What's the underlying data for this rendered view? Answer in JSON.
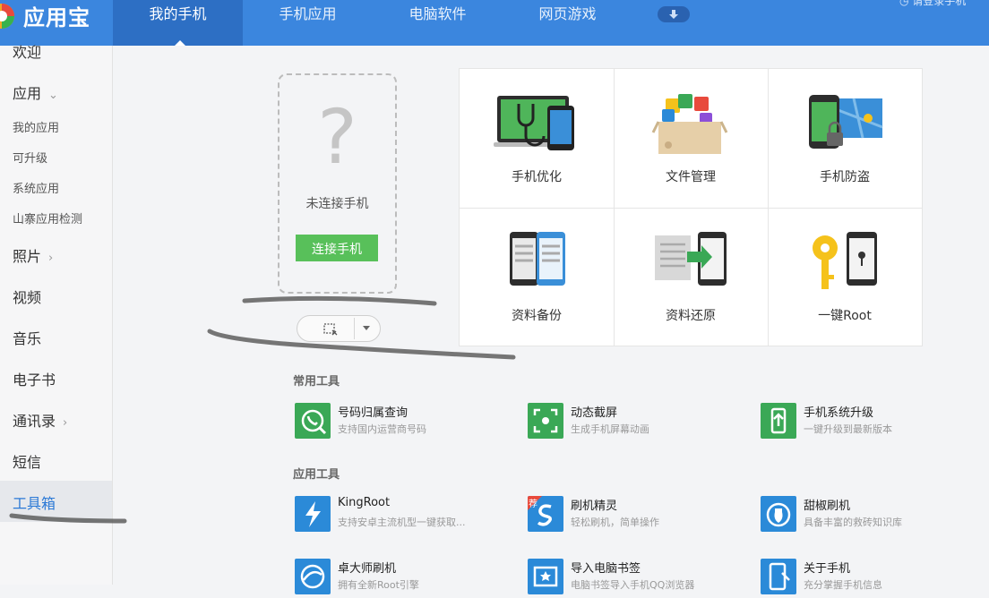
{
  "app": {
    "title": "应用宝",
    "brand_color": "#3b86de"
  },
  "nav": {
    "tabs": [
      {
        "label": "我的手机"
      },
      {
        "label": "手机应用"
      },
      {
        "label": "电脑软件"
      },
      {
        "label": "网页游戏"
      }
    ],
    "active_tab": "我的手机",
    "top_right_text": "请登录手机"
  },
  "sidebar": {
    "items": [
      {
        "label": "欢迎"
      },
      {
        "label": "应用"
      },
      {
        "label": "我的应用"
      },
      {
        "label": "可升级"
      },
      {
        "label": "系统应用"
      },
      {
        "label": "山寨应用检测"
      },
      {
        "label": "照片"
      },
      {
        "label": "视频"
      },
      {
        "label": "音乐"
      },
      {
        "label": "电子书"
      },
      {
        "label": "通讯录"
      },
      {
        "label": "短信"
      },
      {
        "label": "工具箱"
      }
    ],
    "active": "工具箱"
  },
  "device": {
    "status": "未连接手机",
    "connect_button": "连接手机",
    "placeholder_glyph": "?"
  },
  "features": [
    {
      "label": "手机优化",
      "icon": "phone-optimize-icon"
    },
    {
      "label": "文件管理",
      "icon": "file-manager-icon"
    },
    {
      "label": "手机防盗",
      "icon": "anti-theft-icon"
    },
    {
      "label": "资料备份",
      "icon": "backup-icon"
    },
    {
      "label": "资料还原",
      "icon": "restore-icon"
    },
    {
      "label": "一键Root",
      "icon": "root-key-icon"
    }
  ],
  "common_tools": {
    "title": "常用工具",
    "items": [
      {
        "name": "号码归属查询",
        "desc": "支持国内运营商号码",
        "icon": "phone-lookup-icon",
        "color": "#3aa856"
      },
      {
        "name": "动态截屏",
        "desc": "生成手机屏幕动画",
        "icon": "screen-capture-icon",
        "color": "#3aa856"
      },
      {
        "name": "手机系统升级",
        "desc": "一键升级到最新版本",
        "icon": "system-upgrade-icon",
        "color": "#3aa856"
      }
    ]
  },
  "app_tools": {
    "title": "应用工具",
    "items": [
      {
        "name": "KingRoot",
        "desc": "支持安卓主流机型一键获取...",
        "icon": "kingroot-icon",
        "color": "#2b8ad8"
      },
      {
        "name": "刷机精灵",
        "desc": "轻松刷机，简单操作",
        "icon": "flash-wizard-icon",
        "color": "#2b8ad8",
        "badge": "荐"
      },
      {
        "name": "甜椒刷机",
        "desc": "具备丰富的救砖知识库",
        "icon": "tianjiao-icon",
        "color": "#2b8ad8"
      },
      {
        "name": "卓大师刷机",
        "desc": "拥有全新Root引擎",
        "icon": "zhuodashi-icon",
        "color": "#2b8ad8"
      },
      {
        "name": "导入电脑书签",
        "desc": "电脑书签导入手机QQ浏览器",
        "icon": "bookmark-import-icon",
        "color": "#2b8ad8"
      },
      {
        "name": "关于手机",
        "desc": "充分掌握手机信息",
        "icon": "about-phone-icon",
        "color": "#2b8ad8"
      }
    ]
  }
}
